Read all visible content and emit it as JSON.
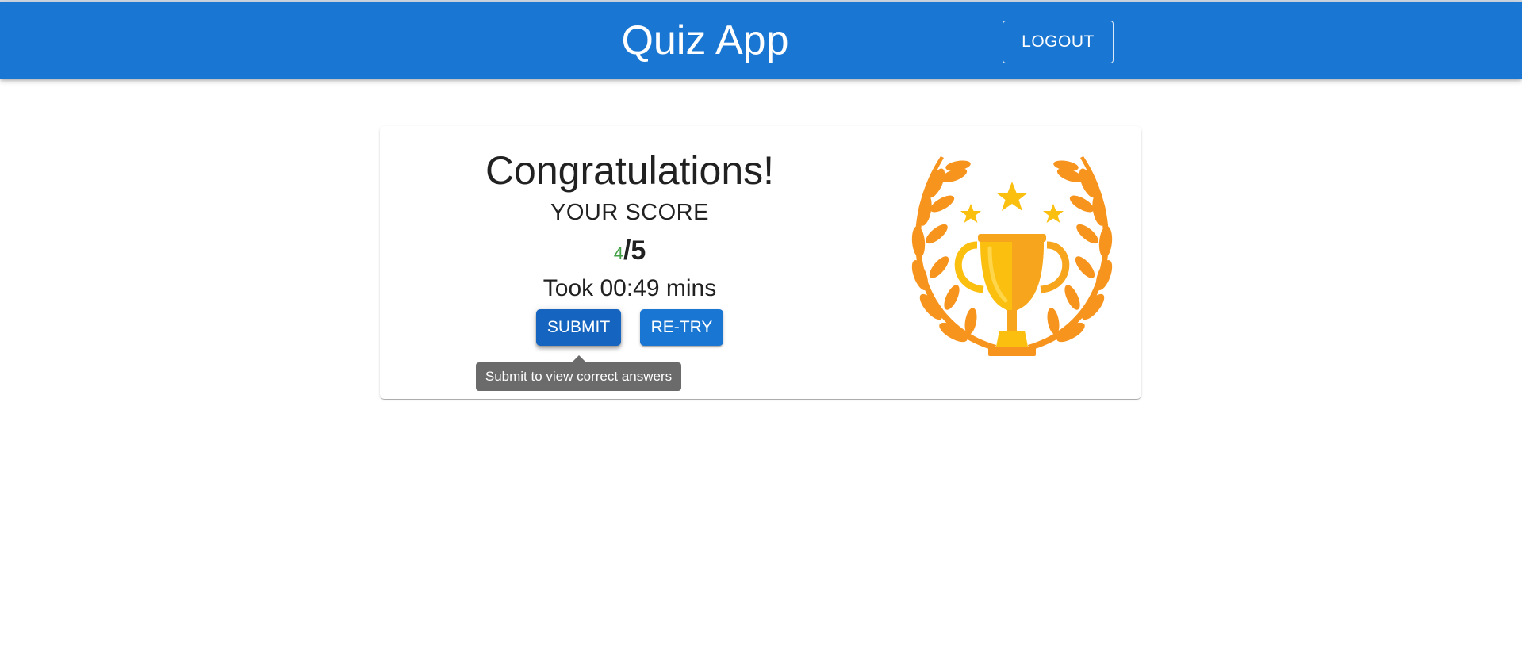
{
  "header": {
    "title": "Quiz App",
    "logout_label": "LOGOUT"
  },
  "result": {
    "heading": "Congratulations!",
    "score_label": "YOUR SCORE",
    "score_correct": "4",
    "score_total": "/5",
    "time_text": "Took 00:49 mins",
    "submit_label": "SUBMIT",
    "retry_label": "RE-TRY",
    "tooltip": "Submit to view correct answers",
    "trophy_icon": "trophy-laurel-icon"
  },
  "colors": {
    "primary": "#1976d2",
    "primary_dark": "#1565c0",
    "success": "#43a047",
    "tooltip_bg": "#6b6b6b",
    "trophy_gold": "#fbbf0f",
    "laurel_orange": "#f7941d"
  }
}
